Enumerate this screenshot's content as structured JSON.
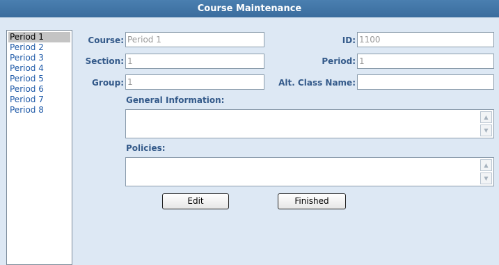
{
  "title": "Course Maintenance",
  "periods": [
    "Period 1",
    "Period 2",
    "Period 3",
    "Period 4",
    "Period 5",
    "Period 6",
    "Period 7",
    "Period 8"
  ],
  "selected_period": "Period 1",
  "form": {
    "course_label": "Course:",
    "course_value": "Period 1",
    "id_label": "ID:",
    "id_value": "1100",
    "section_label": "Section:",
    "section_value": "1",
    "period_label": "Period:",
    "period_value": "1",
    "group_label": "Group:",
    "group_value": "1",
    "alt_class_label": "Alt. Class Name:",
    "alt_class_value": "",
    "general_info_label": "General Information:",
    "general_info_value": "",
    "policies_label": "Policies:",
    "policies_value": ""
  },
  "buttons": {
    "edit": "Edit",
    "finished": "Finished"
  }
}
